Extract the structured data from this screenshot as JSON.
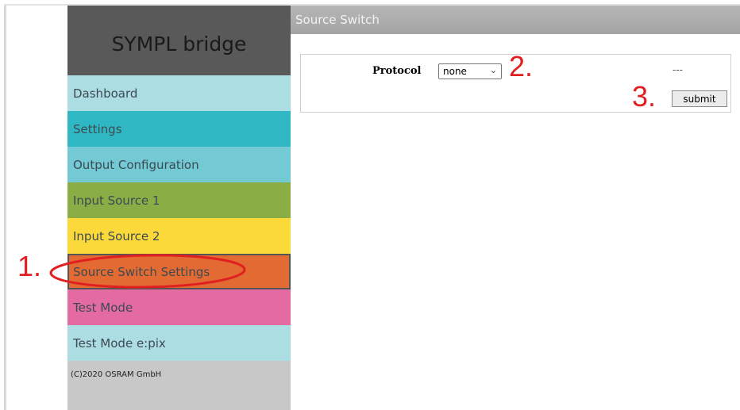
{
  "sidebar": {
    "brand": "SYMPL bridge",
    "items": [
      {
        "label": "Dashboard",
        "color": "#acdde3"
      },
      {
        "label": "Settings",
        "color": "#2fb8c4"
      },
      {
        "label": "Output Configuration",
        "color": "#73c9d4"
      },
      {
        "label": "Input Source 1",
        "color": "#8bad45"
      },
      {
        "label": "Input Source 2",
        "color": "#fbd93a"
      },
      {
        "label": "Source Switch Settings",
        "color": "#e36a33"
      },
      {
        "label": "Test Mode",
        "color": "#e36ba2"
      },
      {
        "label": "Test Mode e:pix",
        "color": "#acdde3"
      }
    ],
    "copyright": "(C)2020 OSRAM GmbH"
  },
  "page": {
    "title": "Source Switch",
    "protocol_label": "Protocol",
    "protocol_value": "none",
    "status": "---",
    "submit_label": "submit"
  },
  "annotations": {
    "one": "1.",
    "two": "2.",
    "three": "3.",
    "color": "#e02020"
  }
}
